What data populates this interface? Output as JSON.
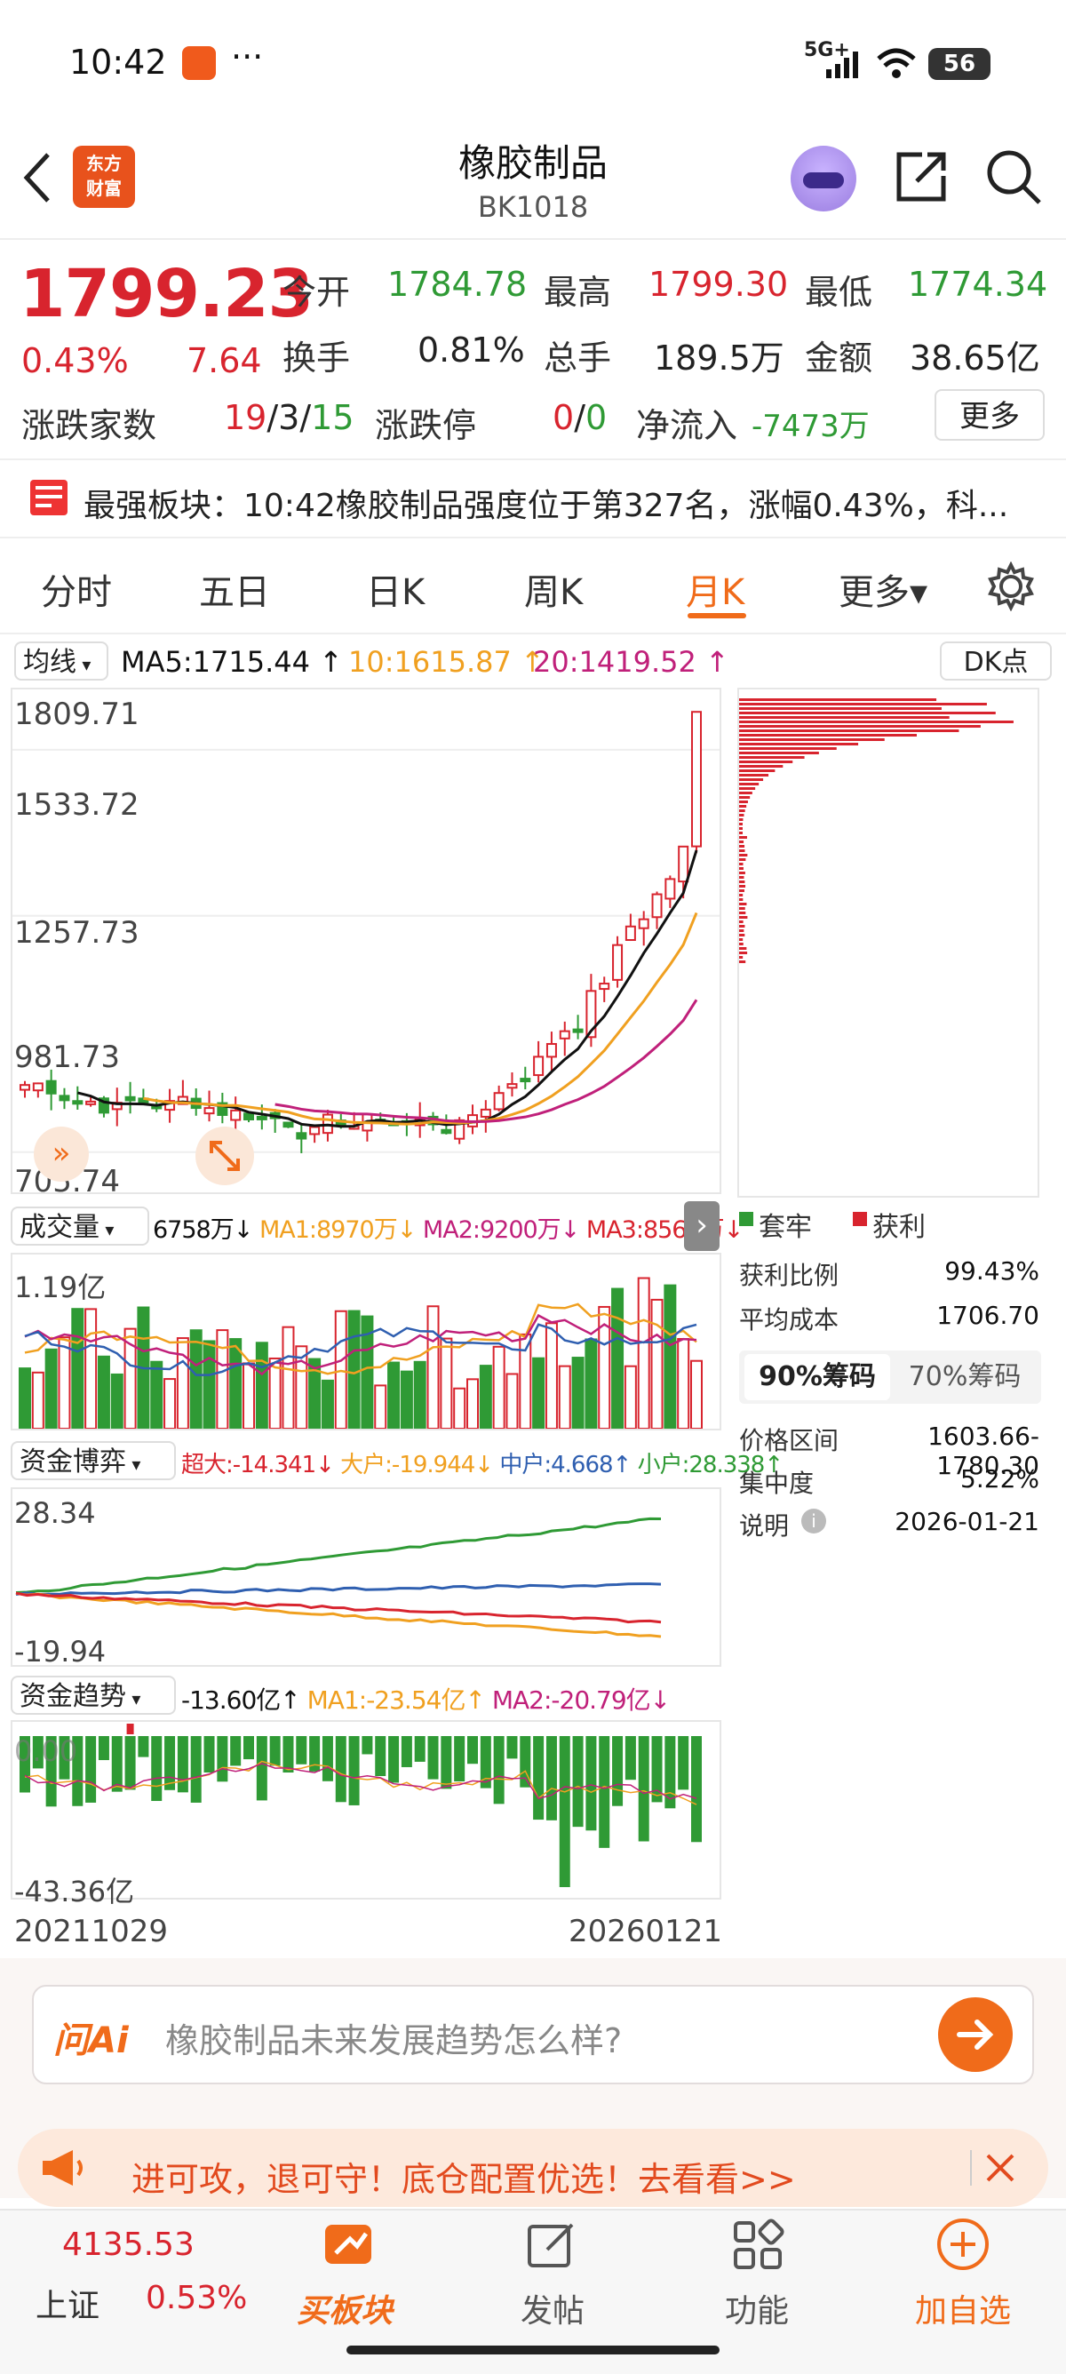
{
  "status_bar": {
    "time": "10:42",
    "dots": "···",
    "network": "5G+",
    "battery": "56"
  },
  "header": {
    "logo_text": "东方\n财富",
    "title": "橡胶制品",
    "code": "BK1018"
  },
  "quote": {
    "price": "1799.23",
    "change_pct": "0.43%",
    "change": "7.64",
    "labels": {
      "open": "今开",
      "high": "最高",
      "low": "最低",
      "turnover": "换手",
      "volume": "总手",
      "amount": "金额",
      "updown_count": "涨跌家数",
      "limit": "涨跌停",
      "net_inflow": "净流入"
    },
    "open": "1784.78",
    "high": "1799.30",
    "low": "1774.34",
    "turnover": "0.81%",
    "volume": "189.5万",
    "amount": "38.65亿",
    "up": "19",
    "flat": "3",
    "down": "15",
    "sep": "/",
    "limit_up": "0",
    "limit_down": "0",
    "net_inflow": "-7473万",
    "more_btn": "更多"
  },
  "banner": {
    "text": "最强板块：10:42橡胶制品强度位于第327名，涨幅0.43%，科..."
  },
  "tabs": [
    "分时",
    "五日",
    "日K",
    "周K",
    "月K",
    "更多▾"
  ],
  "active_tab": 4,
  "kline": {
    "ma_selector": "均线",
    "ma5": "MA5:1715.44 ↑",
    "ma10": "10:1615.87 ↑",
    "ma20": "20:1419.52 ↑",
    "dk_btn": "DK点",
    "y_labels": [
      "1809.71",
      "1533.72",
      "1257.73",
      "981.73",
      "705.74"
    ]
  },
  "chip_panel": {
    "legend_trap": "套牢",
    "legend_profit": "获利",
    "rows": [
      {
        "label": "获利比例",
        "value": "99.43%"
      },
      {
        "label": "平均成本",
        "value": "1706.70"
      }
    ],
    "tab_90": "90%筹码",
    "tab_70": "70%筹码",
    "rows2": [
      {
        "label": "价格区间",
        "value": "1603.66-1780.30"
      },
      {
        "label": "集中度",
        "value": "5.22%"
      },
      {
        "label": "说明",
        "value": "2026-01-21"
      }
    ]
  },
  "volume": {
    "selector": "成交量",
    "vol": "6758万↓",
    "ma1": "MA1:8970万↓",
    "ma2": "MA2:9200万↓",
    "ma3": "MA3:8565万↓",
    "y_top": "1.19亿"
  },
  "fund_game": {
    "selector": "资金博弈",
    "super": "超大:-14.341↓",
    "big": "大户:-19.944↓",
    "mid": "中户:4.668↑",
    "small": "小户:28.338↑",
    "y_top": "28.34",
    "y_bot": "-19.94"
  },
  "fund_trend": {
    "selector": "资金趋势",
    "value": "-13.60亿↑",
    "ma1": "MA1:-23.54亿↑",
    "ma2": "MA2:-20.79亿↓",
    "y_top": "0.00",
    "y_bot": "-43.36亿"
  },
  "dates": {
    "start": "20211029",
    "end": "20260121"
  },
  "ai": {
    "label": "问Ai",
    "placeholder": "橡胶制品未来发展趋势怎么样?"
  },
  "promo": {
    "text": "进可攻，退可守！底仓配置优选！去看看>>"
  },
  "bottom": {
    "index_value": "4135.53",
    "index_name": "上证",
    "index_pct": "0.53%",
    "buy": "买板块",
    "post": "发帖",
    "func": "功能",
    "add": "加自选"
  },
  "colors": {
    "up": "#d8242e",
    "down": "#2f9a35",
    "accent": "#f06b1a",
    "ma5": "#000000",
    "ma10": "#f0a020",
    "ma20": "#c0207a"
  }
}
